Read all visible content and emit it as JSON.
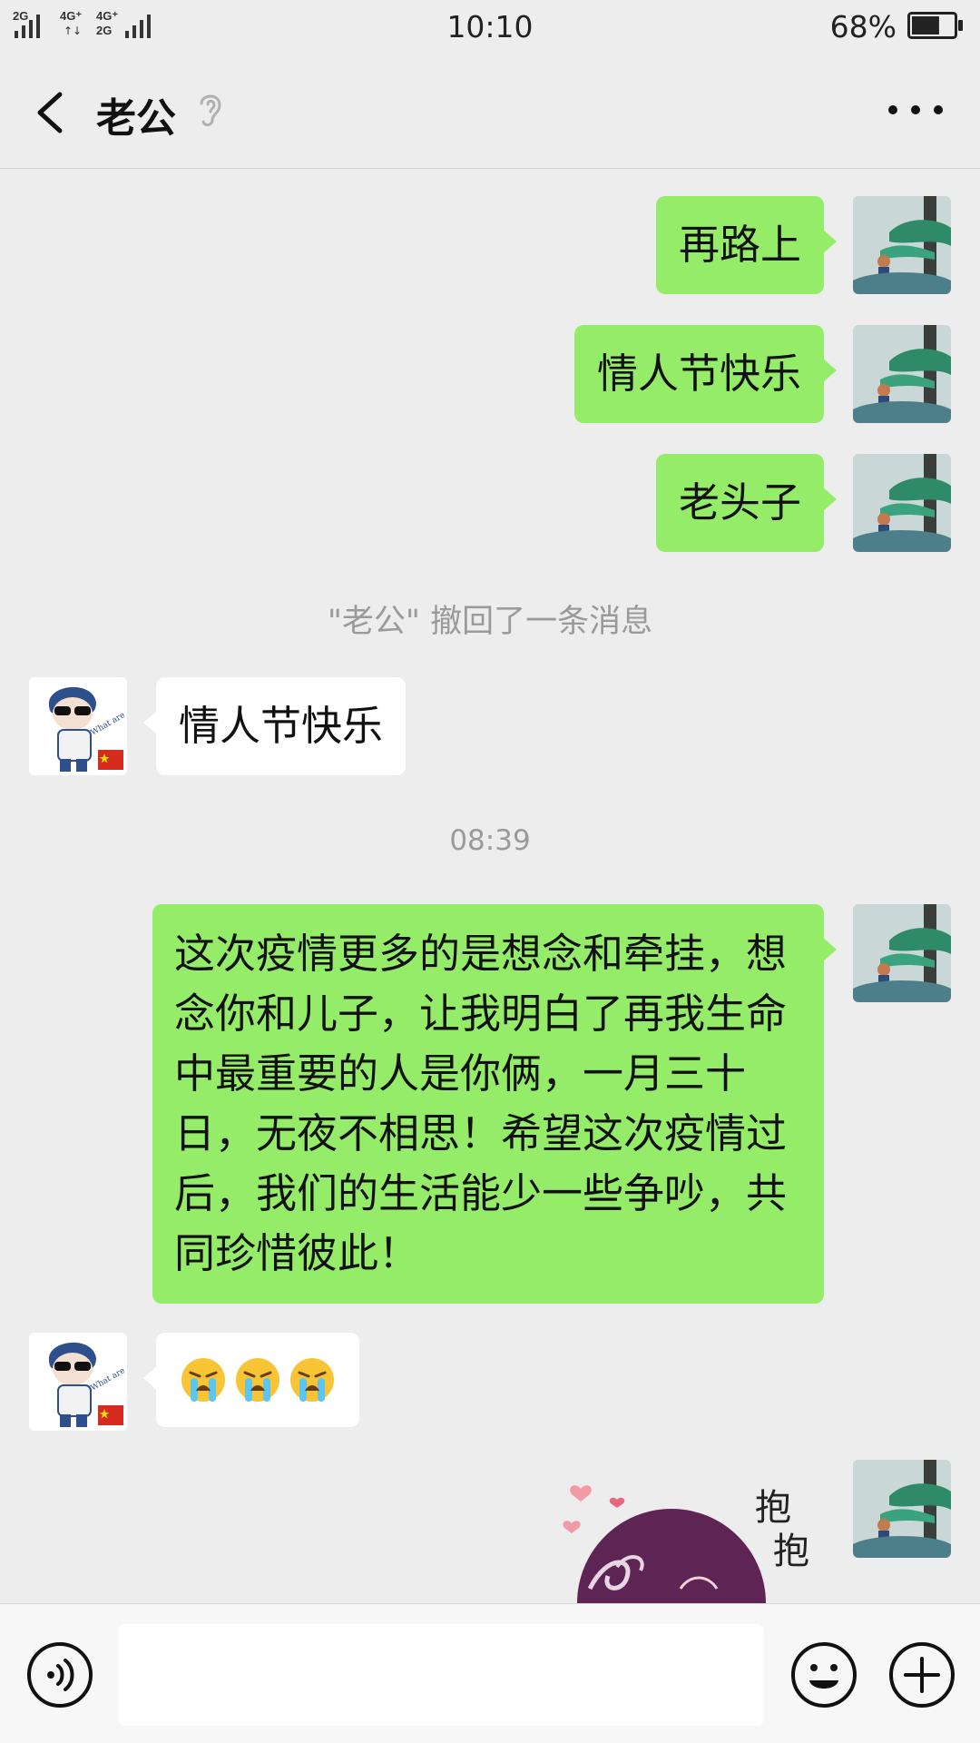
{
  "status_bar": {
    "signal_1": "2G",
    "signal_2": "4G⁺",
    "signal_3": "4G⁺",
    "signal_4": "2G",
    "time": "10:10",
    "battery_percent": "68%",
    "battery_level": 0.68
  },
  "nav": {
    "title": "老公",
    "back_icon": "chevron-left-icon",
    "ear_icon": "ear-icon",
    "more_icon": "more-dots-icon"
  },
  "messages": {
    "m1": "再路上",
    "m2": "情人节快乐",
    "m3": "老头子",
    "recall": "\"老公\" 撤回了一条消息",
    "m4": "情人节快乐",
    "time_stamp": "08:39",
    "m5": "这次疫情更多的是想念和牵挂，想念你和儿子，让我明白了再我生命中最重要的人是你俩，一月三十日，无夜不相思！希望这次疫情过后，我们的生活能少一些争吵，共同珍惜彼此！",
    "m6_emoji": "crying-face-icon ×3",
    "sticker_text_1": "抱",
    "sticker_text_2": "抱"
  },
  "input_bar": {
    "voice_icon": "voice-icon",
    "input_value": "",
    "emoji_icon": "emoji-icon",
    "plus_icon": "plus-icon"
  },
  "colors": {
    "background": "#ededed",
    "bubble_self": "#95ec69",
    "bubble_other": "#ffffff",
    "system_text": "#9a9a9a"
  }
}
